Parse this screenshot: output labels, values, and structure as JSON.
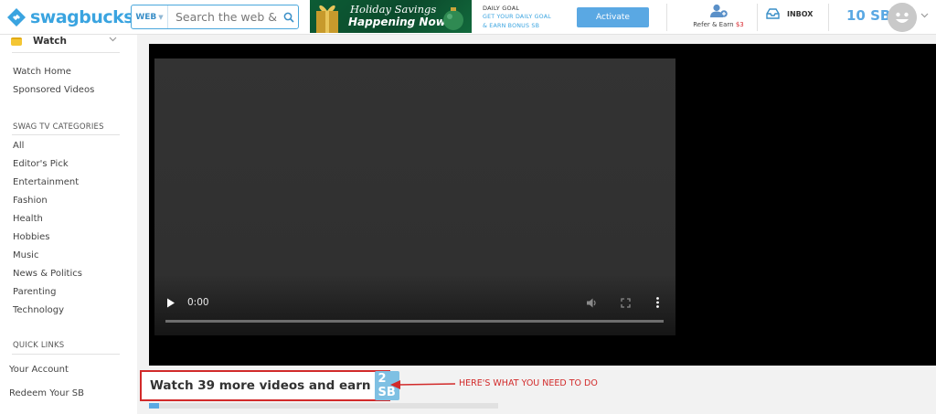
{
  "header": {
    "logo_text": "swagbucks",
    "search": {
      "scope": "WEB",
      "placeholder": "Search the web & earn"
    },
    "banner": {
      "line1": "Holiday Savings",
      "line2": "Happening Now!"
    },
    "daily_goal": {
      "title": "DAILY GOAL",
      "line1": "GET YOUR DAILY GOAL",
      "line2": "& EARN BONUS SB"
    },
    "activate_label": "Activate",
    "refer": {
      "label": "Refer & Earn",
      "amount": "$3"
    },
    "inbox_label": "INBOX",
    "sb_balance": "10 SB"
  },
  "sidebar": {
    "dropdown_label": "Watch",
    "links": [
      "Watch Home",
      "Sponsored Videos"
    ],
    "categories_title": "SWAG TV CATEGORIES",
    "categories": [
      "All",
      "Editor's Pick",
      "Entertainment",
      "Fashion",
      "Health",
      "Hobbies",
      "Music",
      "News & Politics",
      "Parenting",
      "Technology"
    ],
    "quick_links_title": "QUICK LINKS",
    "quick_links": [
      "Your Account",
      "Redeem Your SB"
    ]
  },
  "player": {
    "current_time": "0:00",
    "progress_fraction": 0
  },
  "cta": {
    "text": "Watch 39 more videos and earn",
    "reward": "2 SB",
    "note": "HERE'S WHAT YOU NEED TO DO",
    "progress_fraction": 0.03
  },
  "colors": {
    "brand_blue": "#3aa4e0",
    "activate_blue": "#5aa8e3",
    "annotation_red": "#d22a2a"
  },
  "icons": [
    "swagbucks-logo-icon",
    "search-icon",
    "refer-earn-icon",
    "inbox-icon",
    "avatar-icon",
    "chevron-down-icon",
    "play-icon",
    "volume-icon",
    "fullscreen-icon",
    "more-options-icon"
  ]
}
